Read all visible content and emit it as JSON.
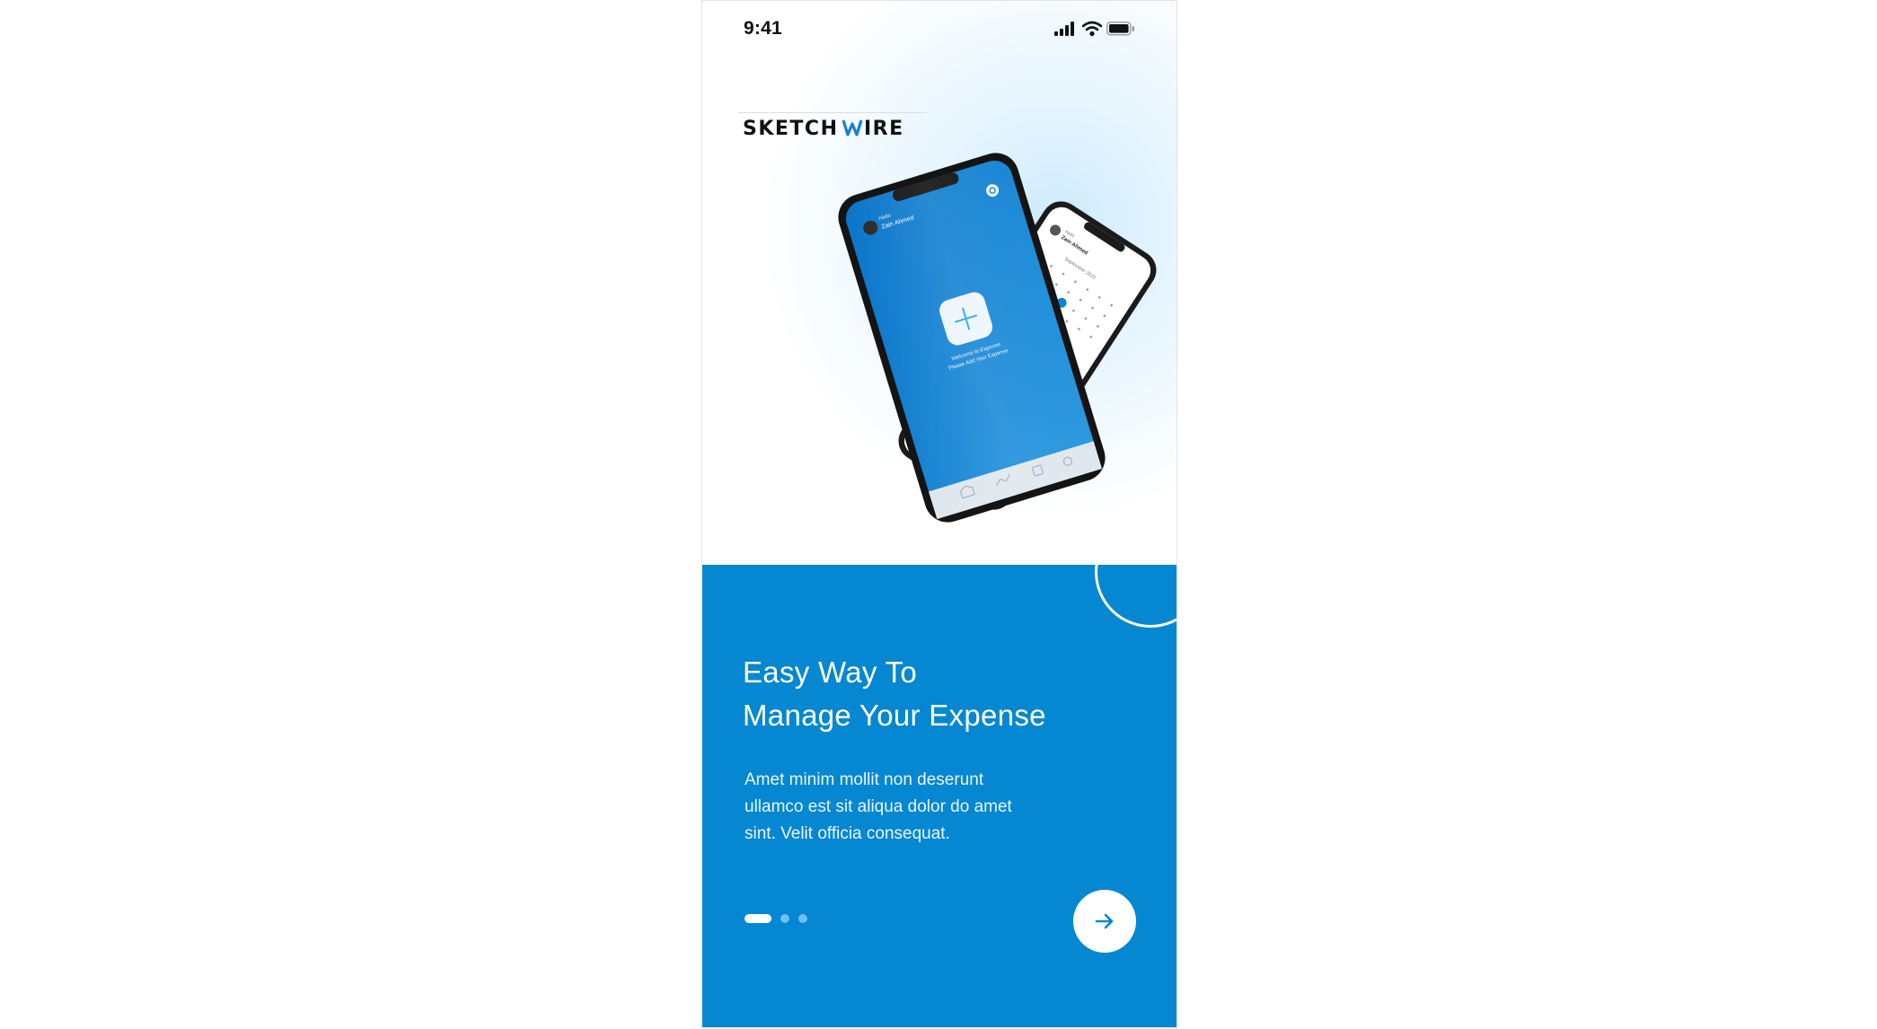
{
  "status_bar": {
    "time": "9:41",
    "icons": [
      "signal-icon",
      "wifi-icon",
      "battery-icon"
    ]
  },
  "brand": {
    "logo_text": "SKETCHWIRE"
  },
  "hero": {
    "mockup_front": {
      "greeting": "Hello",
      "user_name": "Zain Ahmed",
      "welcome_line_1": "Welcome to Expense",
      "welcome_line_2": "Please Add Your Expense"
    },
    "mockup_back": {
      "greeting": "Hello",
      "user_name": "Zain Ahmed",
      "month": "September 2022"
    }
  },
  "onboarding": {
    "title_line_1": "Easy Way To",
    "title_line_2": "Manage Your Expense",
    "description": "Amet minim mollit non deserunt ullamco est sit aliqua dolor do amet sint. Velit officia consequat.",
    "page_indicator": {
      "current": 1,
      "total": 3
    },
    "next_icon": "arrow-right-icon"
  },
  "colors": {
    "primary": "#0587d1",
    "logo_dark": "#111111",
    "logo_accent": "#1a7fd0",
    "hero_glow": "#cdeafc",
    "dot_inactive": "#6fc0ee",
    "white": "#ffffff"
  }
}
